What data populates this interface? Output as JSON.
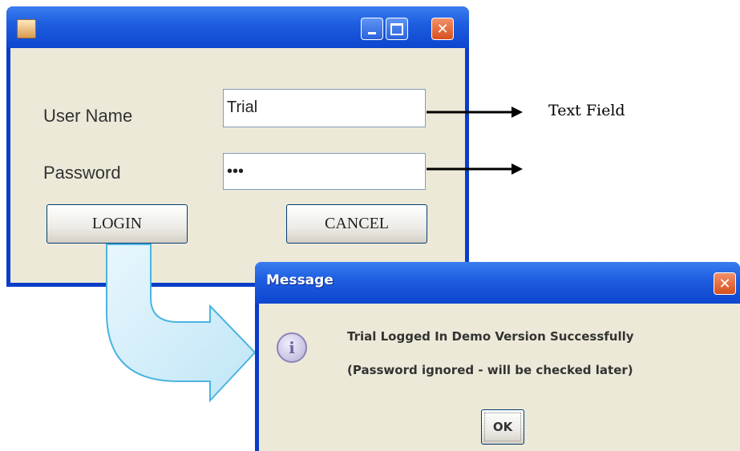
{
  "login_window": {
    "title": "",
    "labels": {
      "user_name": "User Name",
      "password": "Password"
    },
    "fields": {
      "user_name_value": "Trial",
      "password_value": "•••"
    },
    "buttons": {
      "login": "LOGIN",
      "cancel": "CANCEL"
    },
    "controls": {
      "minimize_icon": "minimize-icon",
      "maximize_icon": "maximize-icon",
      "close_icon": "close-icon",
      "close_glyph": "✕"
    }
  },
  "message_dialog": {
    "title": "Message",
    "close_glyph": "✕",
    "info_glyph": "i",
    "lines": [
      "Trial Logged In Demo Version Successfully",
      "(Password ignored - will be checked later)"
    ],
    "ok_label": "OK"
  },
  "annotations": {
    "text_field_label": "Text Field"
  },
  "colors": {
    "titlebar_blue": "#1f5fe0",
    "dialog_face": "#ece9d8",
    "close_orange": "#d6501e",
    "flow_arrow": "#4cb4e0"
  }
}
